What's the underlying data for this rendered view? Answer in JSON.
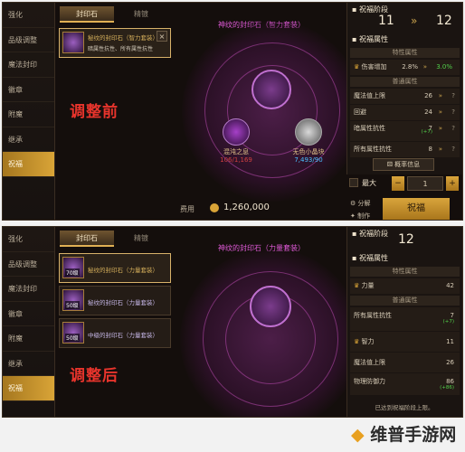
{
  "before": {
    "sidebar": [
      "强化",
      "品级调整",
      "魔法封印",
      "徽章",
      "附魔",
      "继承",
      "祝福"
    ],
    "tabs": [
      "封印石",
      "精镀"
    ],
    "seals": [
      {
        "name": "秘纹的封印石（智力套装）",
        "desc": "暗属性抗性、所有属性抗性"
      }
    ],
    "heading": "神纹的封印石（智力套装）",
    "note": "调整前",
    "materials": [
      {
        "name": "混沌之息",
        "count": "106/1,169"
      },
      {
        "name": "无色小晶块",
        "count": "7,493/90"
      }
    ],
    "cost_label": "费用",
    "cost": "1,260,000",
    "max_label": "最大",
    "qty": "1",
    "split_label": "分解",
    "make_label": "制作",
    "bless_button": "祝福",
    "right": {
      "title": "祝福阶段",
      "stage_from": "11",
      "stage_to": "12",
      "attr_title": "祝福属性",
      "special_title": "特性属性",
      "special_row": {
        "label": "伤害增加",
        "value": "2.8%",
        "next": "3.0%"
      },
      "normal_title": "普通属性",
      "rows": [
        {
          "label": "魔法值上限",
          "value": "26"
        },
        {
          "label": "回避",
          "value": "24"
        },
        {
          "label": "暗属性抗性",
          "value": "7",
          "inc": "(+7)"
        },
        {
          "label": "所有属性抗性",
          "value": "8"
        }
      ],
      "prob_button": "概率信息"
    }
  },
  "after": {
    "sidebar": [
      "强化",
      "品级调整",
      "魔法封印",
      "徽章",
      "附魔",
      "继承",
      "祝福"
    ],
    "tabs": [
      "封印石",
      "精镀"
    ],
    "seals": [
      {
        "name": "秘纹的封印石（力量套装）",
        "level": "70级"
      },
      {
        "name": "秘纹的封印石（力量套装）",
        "level": "50级"
      },
      {
        "name": "中级的封印石（力量套装）",
        "level": "50级"
      }
    ],
    "heading": "神纹的封印石（力量套装）",
    "note": "调整后",
    "right": {
      "title": "祝福阶段",
      "stage": "12",
      "attr_title": "祝福属性",
      "special_title": "特性属性",
      "special_row": {
        "label": "力量",
        "value": "42"
      },
      "normal_title": "普通属性",
      "rows": [
        {
          "label": "所有属性抗性",
          "value": "7",
          "inc": "(+7)"
        },
        {
          "label": "智力",
          "value": "11"
        },
        {
          "label": "魔法值上限",
          "value": "26"
        },
        {
          "label": "物理防御力",
          "value": "86",
          "inc": "(+86)"
        }
      ],
      "footer": "已达到祝福阶段上限。"
    }
  },
  "watermark": "维普手游网",
  "colors": {
    "gold": "#d9a437",
    "pink": "#e05ad8",
    "red_note": "#e8342c",
    "green": "#52d04a"
  }
}
